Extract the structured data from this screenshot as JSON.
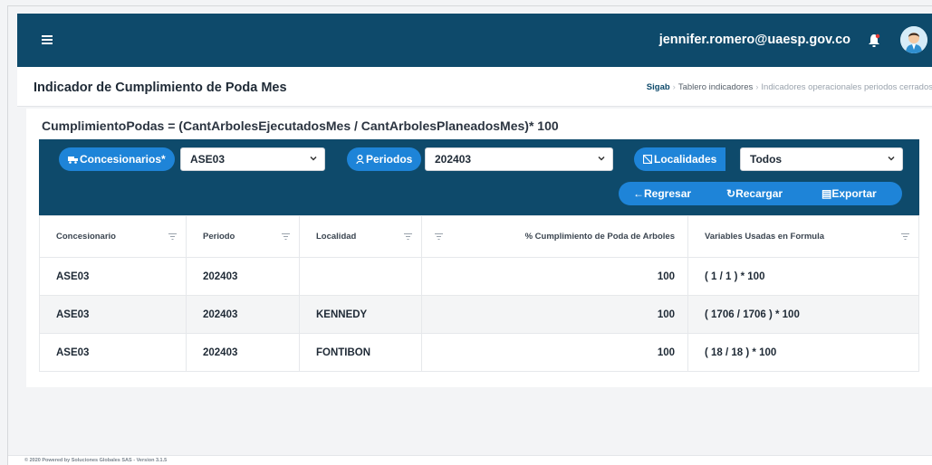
{
  "header": {
    "menu_icon": "hamburger-icon",
    "user_email": "jennifer.romero@uaesp.gov.co",
    "bell_icon": "bell-icon",
    "avatar_icon": "user-avatar-icon"
  },
  "page": {
    "title": "Indicador de Cumplimiento de Poda Mes",
    "breadcrumb": [
      "Sigab",
      "Tablero indicadores",
      "Indicadores operacionales periodos cerrados"
    ]
  },
  "formula": "CumplimientoPodas = (CantArbolesEjecutadosMes / CantArbolesPlaneadosMes)* 100",
  "filters": {
    "concesionarios_label": "Concesionarios*",
    "concesionarios_value": "ASE03",
    "periodos_label": "Periodos",
    "periodos_value": "202403",
    "localidades_label": "Localidades",
    "localidades_value": "Todos"
  },
  "actions": {
    "regresar": "Regresar",
    "recargar": "Recargar",
    "exportar": "Exportar"
  },
  "table": {
    "headers": [
      "Concesionario",
      "Periodo",
      "Localidad",
      "% Cumplimiento de Poda de Arboles",
      "Variables Usadas en Formula"
    ],
    "rows": [
      [
        "ASE03",
        "202403",
        "",
        "100",
        "( 1 / 1 ) * 100"
      ],
      [
        "ASE03",
        "202403",
        "KENNEDY",
        "100",
        "( 1706 / 1706 ) * 100"
      ],
      [
        "ASE03",
        "202403",
        "FONTIBON",
        "100",
        "( 18 / 18 ) * 100"
      ]
    ]
  },
  "footer": "© 2020 Powered by Soluciones Globales SAS - Version 3.1.5",
  "colors": {
    "topbar": "#0e4a6b",
    "accent": "#1e84d8"
  }
}
